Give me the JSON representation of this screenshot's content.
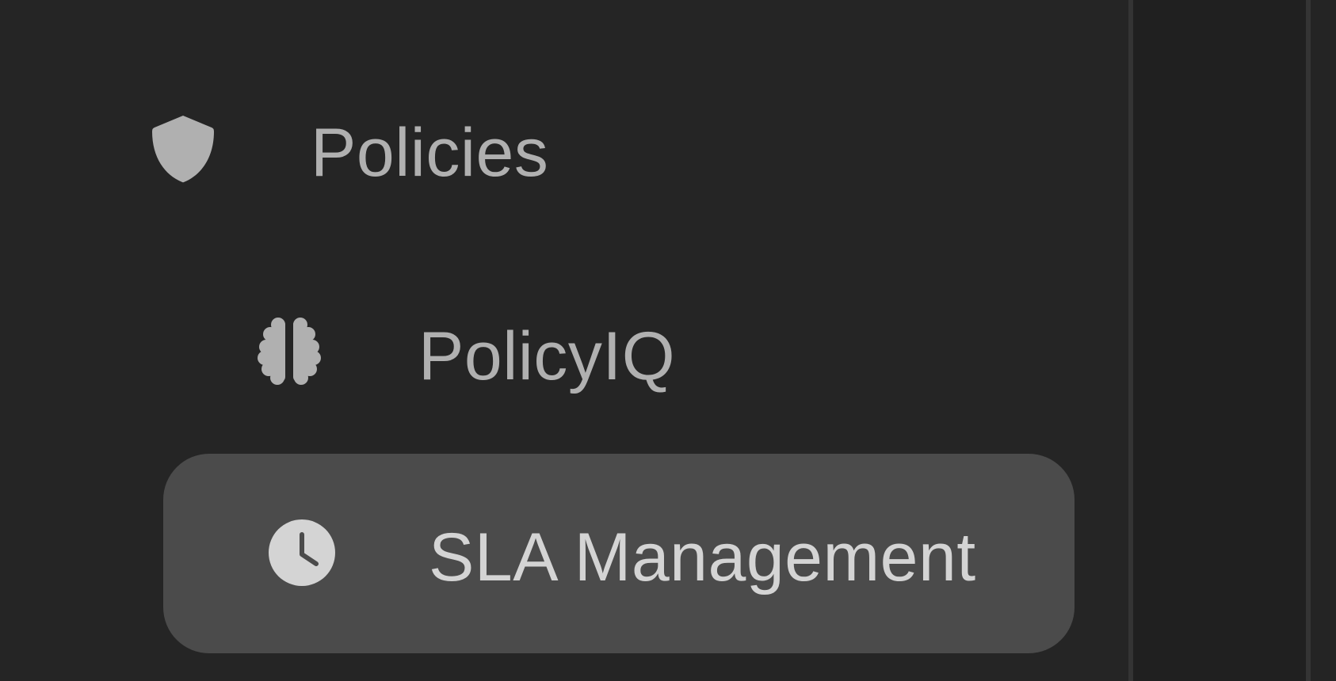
{
  "sidebar": {
    "items": [
      {
        "label": "Policies",
        "icon": "shield-icon",
        "active": false
      },
      {
        "label": "PolicyIQ",
        "icon": "brain-icon",
        "active": false
      },
      {
        "label": "SLA Management",
        "icon": "clock-icon",
        "active": true
      }
    ]
  },
  "colors": {
    "background": "#252525",
    "active_item_background": "#4b4b4b",
    "inactive_text": "#b0b0b0",
    "active_text": "#d4d4d4",
    "divider": "#343434"
  }
}
